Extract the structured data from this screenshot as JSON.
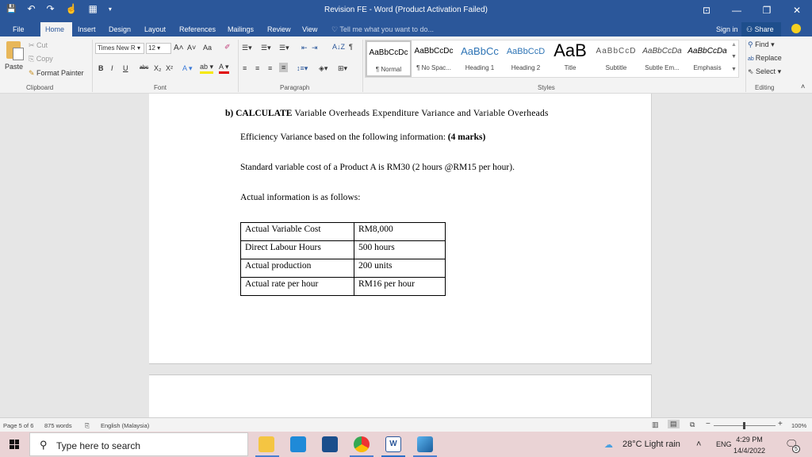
{
  "window": {
    "title": "Revision FE - Word (Product Activation Failed)",
    "controls": {
      "ribbon_display": "⊡",
      "minimize": "—",
      "restore": "❐",
      "close": "✕"
    }
  },
  "qat": {
    "save": "💾",
    "undo": "↶",
    "undo_more": "▾",
    "redo": "↷",
    "touch": "☝",
    "table": "▦",
    "customize": "▾"
  },
  "tabs": [
    {
      "label": "File"
    },
    {
      "label": "Home",
      "active": true
    },
    {
      "label": "Insert"
    },
    {
      "label": "Design"
    },
    {
      "label": "Layout"
    },
    {
      "label": "References"
    },
    {
      "label": "Mailings"
    },
    {
      "label": "Review"
    },
    {
      "label": "View"
    }
  ],
  "tell_me": {
    "placeholder": "Tell me what you want to do..."
  },
  "account": {
    "sign_in": "Sign in",
    "share": "Share"
  },
  "ribbon": {
    "clipboard": {
      "paste": "Paste",
      "cut": "Cut",
      "copy": "Copy",
      "format_painter": "Format Painter",
      "label": "Clipboard"
    },
    "font": {
      "font_name": "Times New R",
      "font_size": "12",
      "grow": "A˄",
      "shrink": "A˅",
      "case": "Aa",
      "bold": "B",
      "italic": "I",
      "underline": "U",
      "strike": "abc",
      "subscript": "X₂",
      "superscript": "X²",
      "label": "Font"
    },
    "paragraph": {
      "label": "Paragraph",
      "sort": "A↓Z",
      "pilcrow": "¶"
    },
    "styles": {
      "label": "Styles",
      "items": [
        {
          "sample": "AaBbCcDc",
          "name": "¶ Normal",
          "selected": true
        },
        {
          "sample": "AaBbCcDc",
          "name": "¶ No Spac..."
        },
        {
          "sample": "AaBbCc",
          "name": "Heading 1"
        },
        {
          "sample": "AaBbCcD",
          "name": "Heading 2"
        },
        {
          "sample": "AaB",
          "name": "Title"
        },
        {
          "sample": "AaBbCcD",
          "name": "Subtitle"
        },
        {
          "sample": "AaBbCcDa",
          "name": "Subtle Em..."
        },
        {
          "sample": "AaBbCcDa",
          "name": "Emphasis"
        }
      ]
    },
    "editing": {
      "find": "Find",
      "replace": "Replace",
      "select": "Select",
      "label": "Editing"
    }
  },
  "document": {
    "line1_bold": "b)  CALCULATE",
    "line1_rest": " Variable Overheads Expenditure Variance and Variable Overheads",
    "line2": "Efficiency Variance based on the following information: ",
    "line2_bold": "(4 marks)",
    "line3": "Standard variable cost of a Product A is RM30 (2 hours @RM15 per hour).",
    "line4": "Actual information is as follows:",
    "table": [
      [
        "Actual Variable Cost",
        "RM8,000"
      ],
      [
        "Direct Labour Hours",
        "500 hours"
      ],
      [
        "Actual production",
        "200 units"
      ],
      [
        "Actual rate per hour",
        "RM16 per hour"
      ]
    ]
  },
  "status": {
    "page": "Page 5 of 6",
    "words": "875 words",
    "language": "English (Malaysia)",
    "zoom": "100%",
    "zoom_level_percent": 100
  },
  "taskbar": {
    "search_placeholder": "Type here to search",
    "weather": "28°C  Light rain",
    "lang": "ENG",
    "time": "4:29 PM",
    "date": "14/4/2022",
    "notifications": "5"
  }
}
